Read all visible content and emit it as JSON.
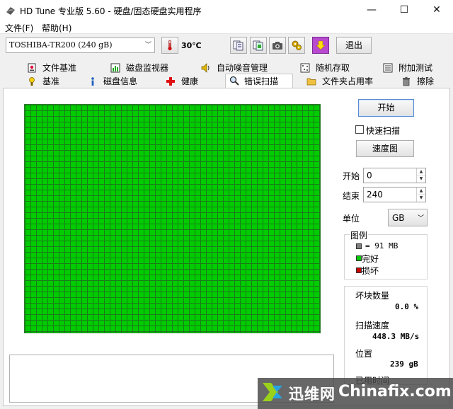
{
  "window": {
    "title": "HD Tune 专业版 5.60 - 硬盘/固态硬盘实用程序",
    "minimize": "—",
    "maximize": "☐",
    "close": "✕"
  },
  "menu": {
    "file": "文件(F)",
    "help": "帮助(H)"
  },
  "toolbar": {
    "drive": "TOSHIBA-TR200 (240 gB)",
    "temperature": "30℃",
    "exit": "退出"
  },
  "tabs_top": [
    {
      "label": "文件基准",
      "icon": "file-benchmark-icon"
    },
    {
      "label": "磁盘监视器",
      "icon": "disk-monitor-icon"
    },
    {
      "label": "自动噪音管理",
      "icon": "speaker-icon"
    },
    {
      "label": "随机存取",
      "icon": "random-access-icon"
    },
    {
      "label": "附加测试",
      "icon": "extra-tests-icon"
    }
  ],
  "tabs_bottom": [
    {
      "label": "基准",
      "icon": "benchmark-icon"
    },
    {
      "label": "磁盘信息",
      "icon": "info-icon"
    },
    {
      "label": "健康",
      "icon": "health-cross-icon"
    },
    {
      "label": "错误扫描",
      "icon": "magnifier-icon",
      "active": true
    },
    {
      "label": "文件夹占用率",
      "icon": "folder-icon"
    },
    {
      "label": "擦除",
      "icon": "trash-icon"
    }
  ],
  "scan": {
    "start_button": "开始",
    "quick_scan_label": "快速扫描",
    "quick_scan_checked": false,
    "speed_map_button": "速度图",
    "start_label": "开始",
    "start_value": "0",
    "end_label": "结束",
    "end_value": "240",
    "unit_label": "单位",
    "unit_value": "GB",
    "block_status": "all-ok",
    "block_color": "#00cc00"
  },
  "legend": {
    "title": "图例",
    "items": [
      {
        "label": "= 91 MB",
        "color": "#808080"
      },
      {
        "label": "完好",
        "color": "#00cc00"
      },
      {
        "label": "损坏",
        "color": "#cc0000"
      }
    ]
  },
  "stats": {
    "bad_blocks_label": "坏块数量",
    "bad_blocks_value": "0.0 %",
    "scan_speed_label": "扫描速度",
    "scan_speed_value": "448.3 MB/s",
    "position_label": "位置",
    "position_value": "239 gB",
    "elapsed_label": "已用时间"
  },
  "watermark": {
    "brand_cn": "迅维网",
    "brand_en": "Chinafix.com"
  }
}
